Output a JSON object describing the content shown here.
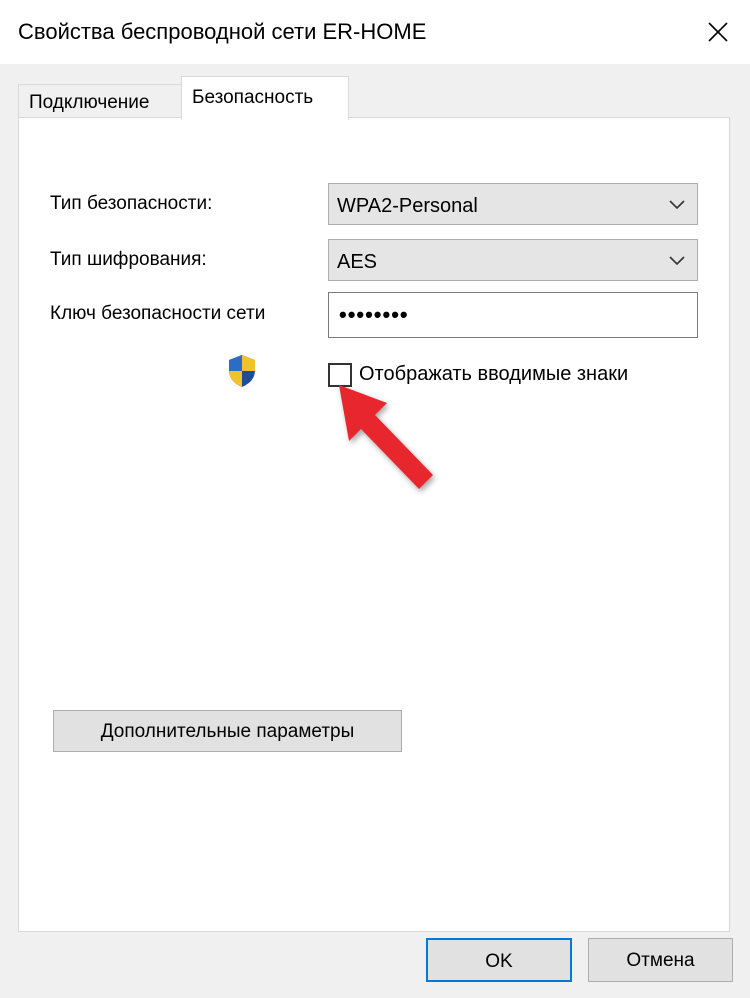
{
  "window": {
    "title": "Свойства беспроводной сети ER-HOME"
  },
  "tabs": [
    {
      "label": "Подключение",
      "active": false
    },
    {
      "label": "Безопасность",
      "active": true
    }
  ],
  "security": {
    "type_label": "Тип безопасности:",
    "type_value": "WPA2-Personal",
    "encryption_label": "Тип шифрования:",
    "encryption_value": "AES",
    "key_label": "Ключ безопасности сети",
    "key_value": "••••••••",
    "show_chars_label": "Отображать вводимые знаки",
    "show_chars_checked": false
  },
  "buttons": {
    "advanced": "Дополнительные параметры",
    "ok": "OK",
    "cancel": "Отмена"
  },
  "colors": {
    "accent": "#0078d7",
    "annotation_arrow": "#e8262f"
  }
}
